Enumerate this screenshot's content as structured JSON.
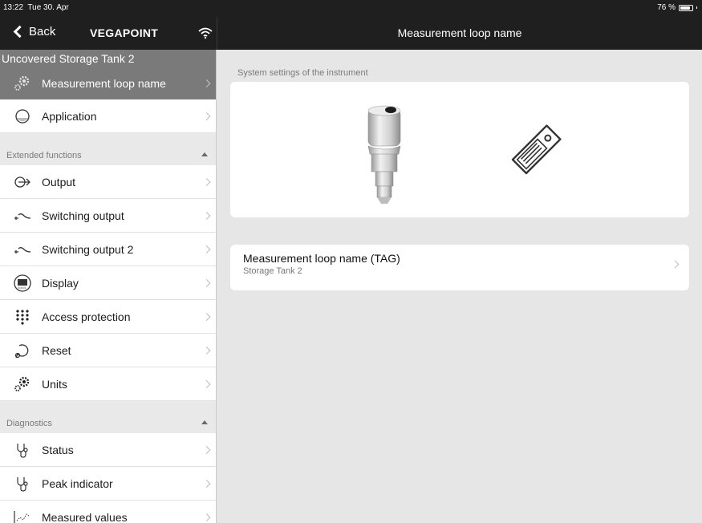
{
  "status_bar": {
    "time": "13:22",
    "date": "Tue 30. Apr",
    "battery": "76 %",
    "battery_level": 0.76
  },
  "nav": {
    "back_label": "Back",
    "title": "VEGAPOINT",
    "wifi_icon": "wifi-icon"
  },
  "main_header": {
    "title": "Measurement loop name"
  },
  "sidebar": {
    "device_name": "Uncovered Storage Tank 2",
    "top_items": [
      {
        "label": "Measurement loop name",
        "icon": "gears-icon",
        "selected": true
      },
      {
        "label": "Application",
        "icon": "tank-icon"
      }
    ],
    "extended_section": "Extended functions",
    "extended_items": [
      {
        "label": "Output",
        "icon": "output-arrow-icon"
      },
      {
        "label": "Switching output",
        "icon": "switch-icon"
      },
      {
        "label": "Switching output 2",
        "icon": "switch-icon"
      },
      {
        "label": "Display",
        "icon": "display-icon"
      },
      {
        "label": "Access protection",
        "icon": "keypad-icon"
      },
      {
        "label": "Reset",
        "icon": "reset-icon"
      },
      {
        "label": "Units",
        "icon": "gears-icon"
      }
    ],
    "diagnostics_section": "Diagnostics",
    "diagnostics_items": [
      {
        "label": "Status",
        "icon": "stethoscope-icon"
      },
      {
        "label": "Peak indicator",
        "icon": "stethoscope-icon"
      },
      {
        "label": "Measured values",
        "icon": "chart-icon"
      }
    ]
  },
  "main": {
    "caption": "System settings of the instrument",
    "tag_row": {
      "title": "Measurement loop name (TAG)",
      "value": "Storage Tank 2"
    }
  }
}
